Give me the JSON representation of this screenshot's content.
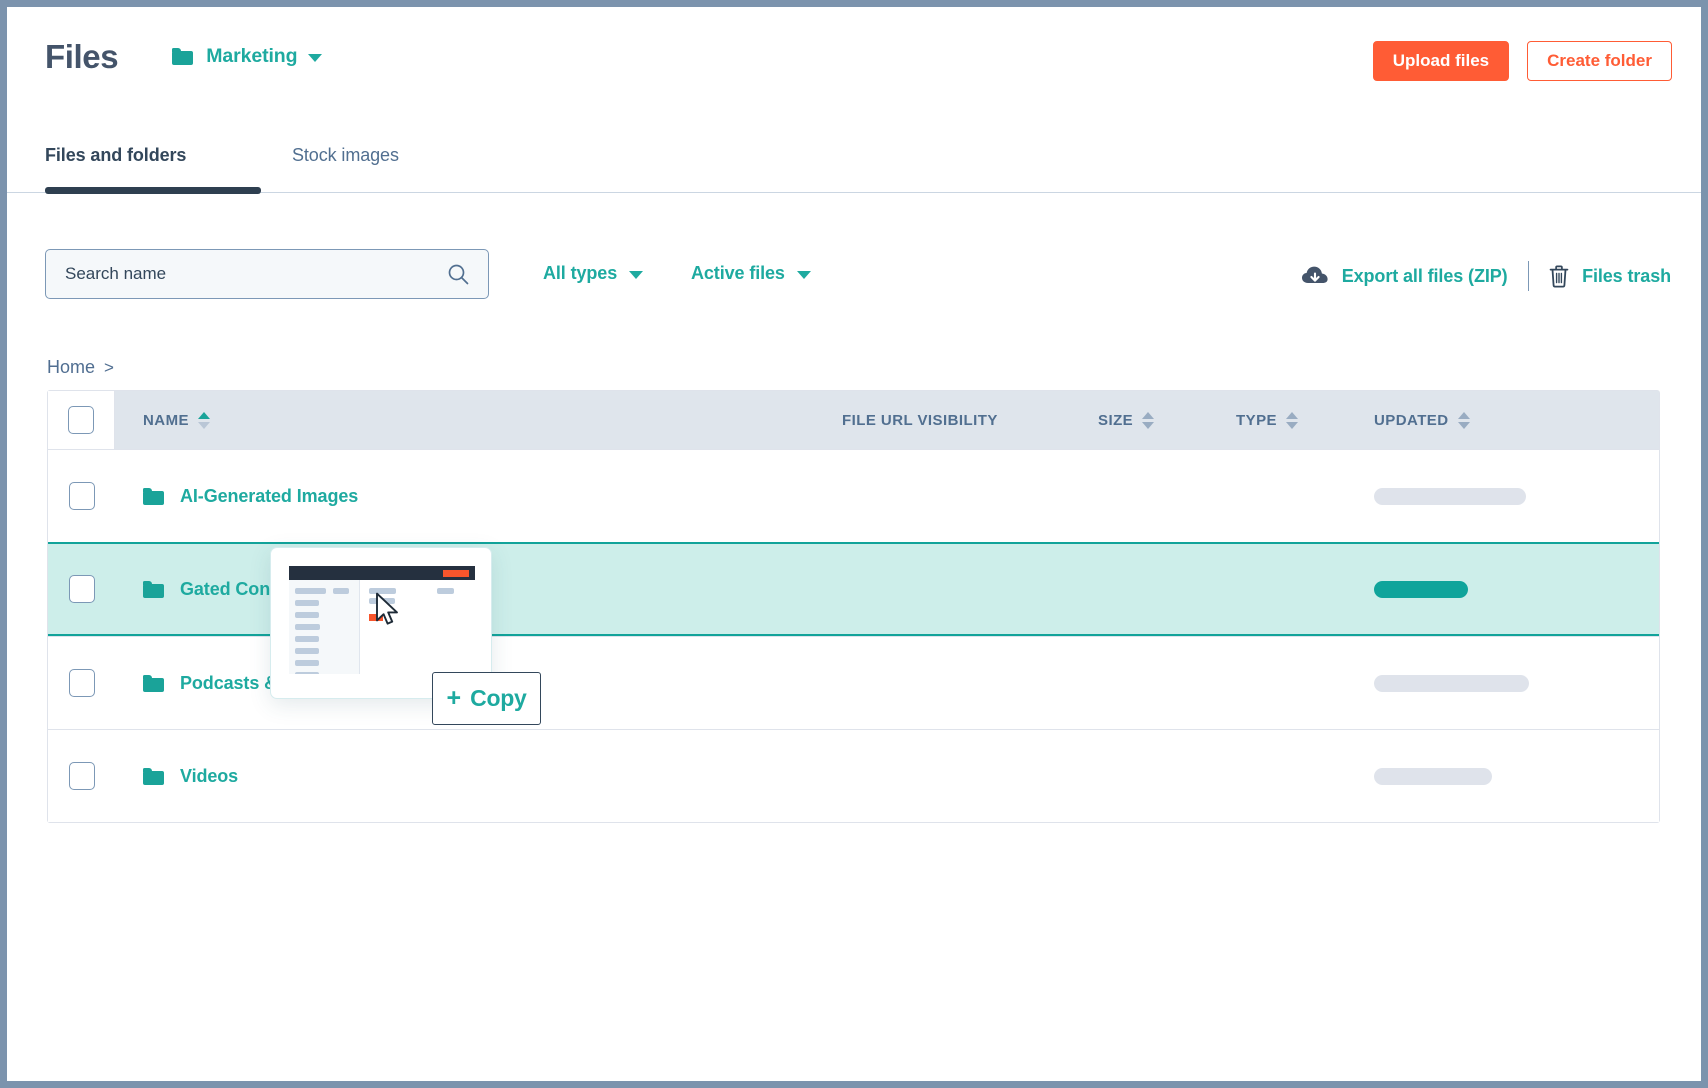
{
  "header": {
    "title": "Files",
    "folder_selector": {
      "icon": "folder-icon",
      "label": "Marketing",
      "caret": "chevron-down-icon"
    },
    "upload_label": "Upload files",
    "create_folder_label": "Create folder"
  },
  "tabs": [
    {
      "label": "Files and folders",
      "active": true
    },
    {
      "label": "Stock images",
      "active": false
    }
  ],
  "toolbar": {
    "search": {
      "placeholder": "Search name",
      "value": "",
      "icon": "search-icon"
    },
    "filters": [
      {
        "label": "All types",
        "icon": "chevron-down-icon"
      },
      {
        "label": "Active files",
        "icon": "chevron-down-icon"
      }
    ],
    "export_label": "Export all files (ZIP)",
    "export_icon": "cloud-download-icon",
    "trash_label": "Files trash",
    "trash_icon": "trash-icon"
  },
  "breadcrumb": {
    "items": [
      "Home"
    ],
    "separator": ">"
  },
  "table": {
    "columns": [
      {
        "key": "name",
        "label": "NAME",
        "sortable": true,
        "sorted": "asc"
      },
      {
        "key": "url",
        "label": "FILE URL VISIBILITY",
        "sortable": false
      },
      {
        "key": "size",
        "label": "SIZE",
        "sortable": true,
        "sorted": "none"
      },
      {
        "key": "type",
        "label": "TYPE",
        "sortable": true,
        "sorted": "none"
      },
      {
        "key": "updated",
        "label": "UPDATED",
        "sortable": true,
        "sorted": "none"
      }
    ],
    "rows": [
      {
        "name": "AI-Generated Images",
        "icon": "folder-icon",
        "checked": false,
        "url": "",
        "size": "",
        "type": "",
        "updated_placeholder_width": 152,
        "drop_target": false
      },
      {
        "name": "Gated Content",
        "icon": "folder-icon",
        "checked": false,
        "url": "",
        "size": "",
        "type": "",
        "updated_placeholder_width": 94,
        "drop_target": true
      },
      {
        "name": "Podcasts & Blog Narration",
        "icon": "folder-icon",
        "checked": false,
        "url": "",
        "size": "",
        "type": "",
        "updated_placeholder_width": 155,
        "drop_target": false
      },
      {
        "name": "Videos",
        "icon": "folder-icon",
        "checked": false,
        "url": "",
        "size": "",
        "type": "",
        "updated_placeholder_width": 118,
        "drop_target": false
      }
    ]
  },
  "drag": {
    "badge_plus": "+",
    "badge_label": "Copy",
    "cursor": "mouse-pointer-icon",
    "preview": "file-thumbnail-preview"
  },
  "colors": {
    "accent_teal": "#1eaaa0",
    "accent_orange": "#ff5c35",
    "text_dark": "#33475b",
    "text_muted": "#516f90",
    "drop_highlight_bg": "#cdeeea",
    "drop_highlight_border": "#12a39a",
    "header_row_bg": "#dfe5ec",
    "window_border": "#7c93ad"
  }
}
